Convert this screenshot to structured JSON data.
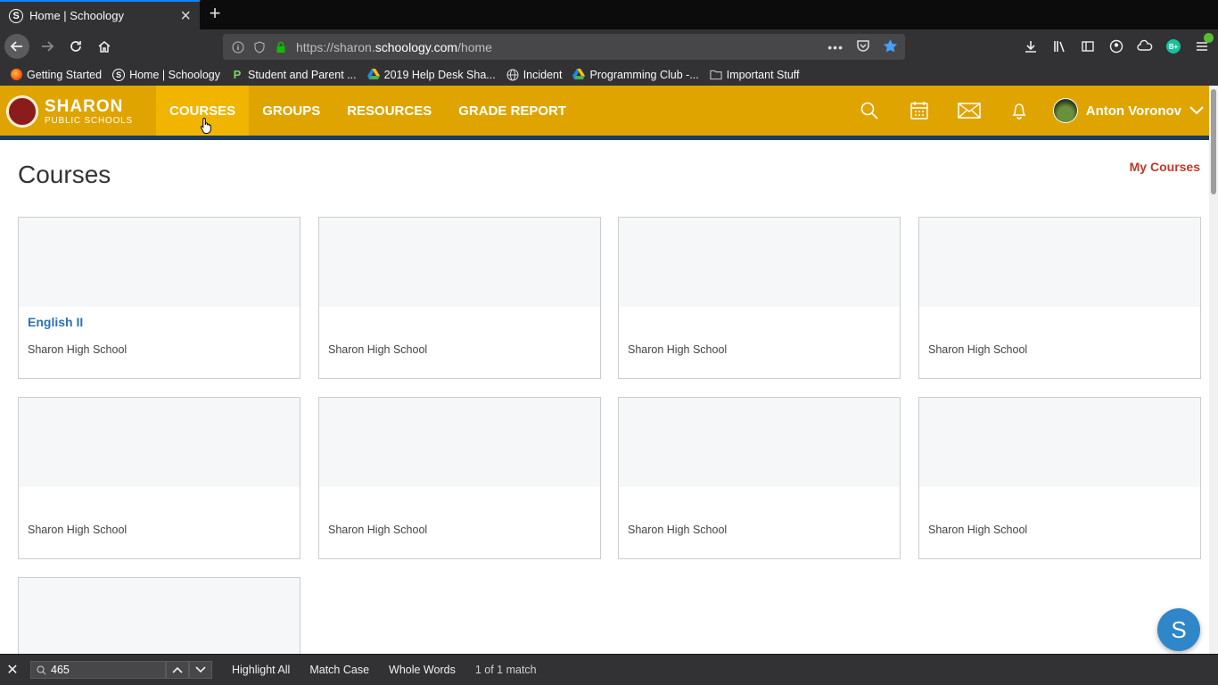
{
  "browser": {
    "tab_title": "Home | Schoology",
    "tab_favicon_letter": "S",
    "url_prefix": "https://sharon.",
    "url_domain": "schoology.com",
    "url_path": "/home",
    "bookmarks": [
      {
        "label": "Getting Started",
        "icon": "firefox-icon"
      },
      {
        "label": "Home | Schoology",
        "icon": "schoology-icon"
      },
      {
        "label": "Student and Parent ...",
        "icon": "p-icon"
      },
      {
        "label": "2019 Help Desk Sha...",
        "icon": "drive-icon"
      },
      {
        "label": "Incident",
        "icon": "globe-icon"
      },
      {
        "label": "Programming Club -...",
        "icon": "drive-icon"
      },
      {
        "label": "Important Stuff",
        "icon": "folder-icon"
      }
    ]
  },
  "header": {
    "logo_line1": "SHARON",
    "logo_line2": "PUBLIC SCHOOLS",
    "nav": [
      "COURSES",
      "GROUPS",
      "RESOURCES",
      "GRADE REPORT"
    ],
    "user_name": "Anton Voronov",
    "colors": {
      "bar": "#dfa400",
      "active": "#f1b500",
      "underline": "#1d3b5d"
    }
  },
  "main": {
    "title": "Courses",
    "my_courses_link": "My Courses",
    "courses": [
      {
        "name": "English II",
        "school": "Sharon High School"
      },
      {
        "name": "",
        "school": "Sharon High School"
      },
      {
        "name": "",
        "school": "Sharon High School"
      },
      {
        "name": "",
        "school": "Sharon High School"
      },
      {
        "name": "",
        "school": "Sharon High School"
      },
      {
        "name": "",
        "school": "Sharon High School"
      },
      {
        "name": "",
        "school": "Sharon High School"
      },
      {
        "name": "",
        "school": "Sharon High School"
      },
      {
        "name": "",
        "school": ""
      }
    ]
  },
  "chat_button_letter": "S",
  "findbar": {
    "query": "465",
    "highlight_all": "Highlight All",
    "match_case": "Match Case",
    "whole_words": "Whole Words",
    "result": "1 of 1 match"
  }
}
